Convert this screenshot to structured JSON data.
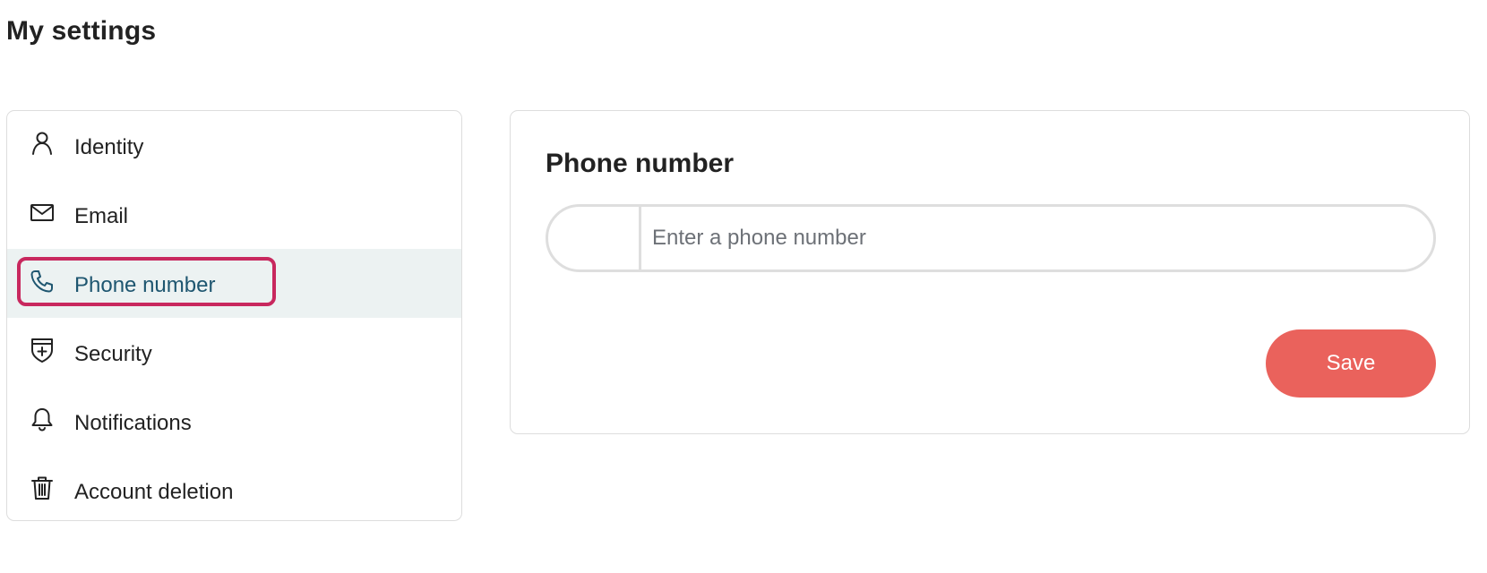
{
  "page": {
    "title": "My settings"
  },
  "sidebar": {
    "items": [
      {
        "label": "Identity",
        "icon": "person-icon",
        "active": false
      },
      {
        "label": "Email",
        "icon": "envelope-icon",
        "active": false
      },
      {
        "label": "Phone number",
        "icon": "phone-icon",
        "active": true
      },
      {
        "label": "Security",
        "icon": "shield-plus-icon",
        "active": false
      },
      {
        "label": "Notifications",
        "icon": "bell-icon",
        "active": false
      },
      {
        "label": "Account deletion",
        "icon": "trash-icon",
        "active": false
      }
    ]
  },
  "panel": {
    "title": "Phone number",
    "phone_input": {
      "placeholder": "Enter a phone number",
      "value": ""
    },
    "save_label": "Save"
  },
  "colors": {
    "active_background": "#ecf2f2",
    "active_text": "#1e5670",
    "highlight_border": "#c8285e",
    "save_button": "#ea625c",
    "border": "#dddddd"
  }
}
